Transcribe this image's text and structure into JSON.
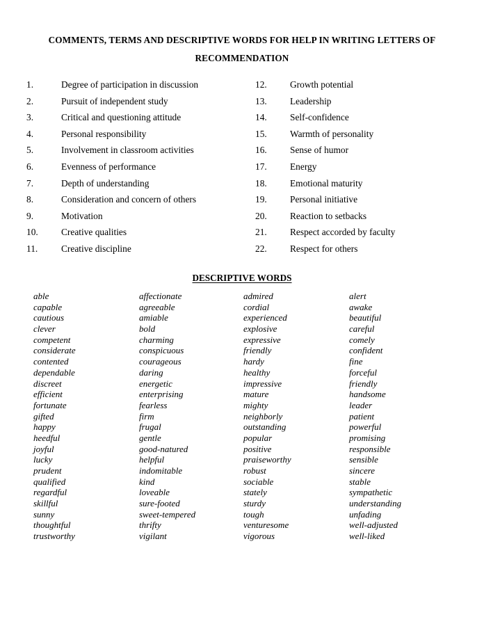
{
  "document": {
    "title_lines": [
      "COMMENTS, TERMS AND DESCRIPTIVE WORDS FOR HELP IN WRITING LETTERS OF",
      "RECOMMENDATION"
    ],
    "background_color": "#ffffff",
    "text_color": "#000000"
  },
  "numbered_list": {
    "left_column": [
      {
        "index": "1.",
        "label": "Degree of participation in discussion"
      },
      {
        "index": "2.",
        "label": "Pursuit of independent study"
      },
      {
        "index": "3.",
        "label": "Critical and questioning attitude"
      },
      {
        "index": "4.",
        "label": "Personal responsibility"
      },
      {
        "index": "5.",
        "label": "Involvement in classroom activities"
      },
      {
        "index": "6.",
        "label": "Evenness of performance"
      },
      {
        "index": "7.",
        "label": "Depth of understanding"
      },
      {
        "index": "8.",
        "label": "Consideration and concern of others"
      },
      {
        "index": "9.",
        "label": "Motivation"
      },
      {
        "index": "10.",
        "label": "Creative qualities"
      },
      {
        "index": "11.",
        "label": "Creative discipline"
      }
    ],
    "right_column": [
      {
        "index": "12.",
        "label": "Growth potential"
      },
      {
        "index": "13.",
        "label": "Leadership"
      },
      {
        "index": "14.",
        "label": "Self-confidence"
      },
      {
        "index": "15.",
        "label": "Warmth of personality"
      },
      {
        "index": "16.",
        "label": "Sense of humor"
      },
      {
        "index": "17.",
        "label": "Energy"
      },
      {
        "index": "18.",
        "label": "Emotional maturity"
      },
      {
        "index": "19.",
        "label": "Personal initiative"
      },
      {
        "index": "20.",
        "label": "Reaction to setbacks"
      },
      {
        "index": "21.",
        "label": "Respect accorded by faculty"
      },
      {
        "index": "22.",
        "label": "Respect for others"
      }
    ]
  },
  "descriptive_words": {
    "heading": "DESCRIPTIVE WORDS",
    "column_1": [
      "able",
      "capable",
      "cautious",
      "clever",
      "competent",
      "considerate",
      "contented",
      "dependable",
      "discreet",
      "efficient",
      "fortunate",
      "gifted",
      "happy",
      "heedful",
      "joyful",
      "lucky",
      "prudent",
      "qualified",
      "regardful",
      "skillful",
      "sunny",
      "thoughtful",
      "trustworthy"
    ],
    "column_2": [
      "affectionate",
      "agreeable",
      "amiable",
      "bold",
      "charming",
      "conspicuous",
      "courageous",
      "daring",
      "energetic",
      "enterprising",
      "fearless",
      "firm",
      "frugal",
      "gentle",
      "good-natured",
      "helpful",
      "indomitable",
      "kind",
      "loveable",
      "sure-footed",
      "sweet-tempered",
      "thrifty",
      "vigilant"
    ],
    "column_3": [
      "admired",
      "cordial",
      "experienced",
      "explosive",
      "expressive",
      "friendly",
      "hardy",
      "healthy",
      "impressive",
      "mature",
      "mighty",
      "neighborly",
      "outstanding",
      "popular",
      "positive",
      "praiseworthy",
      "robust",
      "sociable",
      "stately",
      "sturdy",
      "tough",
      "venturesome",
      "vigorous"
    ],
    "column_4": [
      "alert",
      "awake",
      "beautiful",
      "careful",
      "comely",
      "confident",
      "fine",
      "forceful",
      "friendly",
      "handsome",
      "leader",
      "patient",
      "powerful",
      "promising",
      "responsible",
      "sensible",
      "sincere",
      "stable",
      "sympathetic",
      "understanding",
      "unfading",
      "well-adjusted",
      "well-liked"
    ]
  }
}
